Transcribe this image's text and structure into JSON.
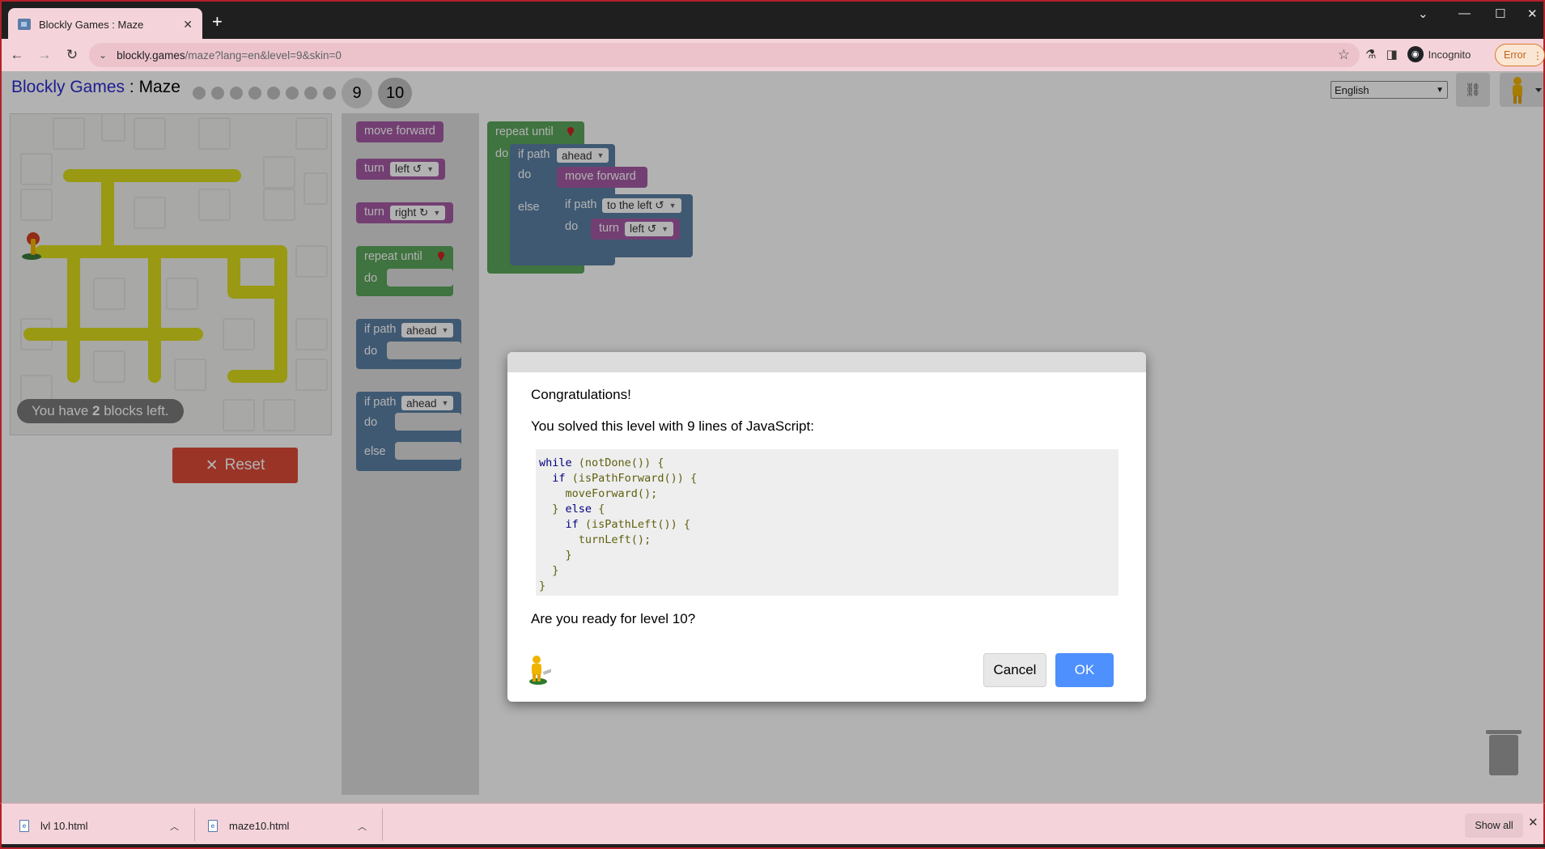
{
  "browser": {
    "tab_title": "Blockly Games : Maze",
    "tab_close": "✕",
    "new_tab": "+",
    "url_host": "blockly.games",
    "url_path": "/maze?lang=en&level=9&skin=0",
    "incognito_label": "Incognito",
    "error_label": "Error"
  },
  "page": {
    "title_link": "Blockly Games",
    "title_sep": " : ",
    "title_game": "Maze",
    "level_dots_count": 8,
    "level_current": "9",
    "level_next": "10",
    "language": "English",
    "blocks_left_prefix": "You have ",
    "blocks_left_count": "2",
    "blocks_left_suffix": " blocks left.",
    "reset_label": "Reset"
  },
  "toolbox": {
    "move_forward": "move forward",
    "turn": "turn",
    "left": "left ↺",
    "right": "right ↻",
    "repeat_until": "repeat until",
    "do": "do",
    "if_path": "if path",
    "ahead": "ahead",
    "else": "else"
  },
  "workspace": {
    "repeat_until": "repeat until",
    "do": "do",
    "if_path": "if path",
    "ahead": "ahead",
    "move_forward": "move forward",
    "else": "else",
    "to_the_left": "to the left ↺",
    "turn": "turn",
    "left": "left ↺"
  },
  "dialog": {
    "congrats": "Congratulations!",
    "solved": "You solved this level with 9 lines of JavaScript:",
    "code": [
      "while (notDone()) {",
      "  if (isPathForward()) {",
      "    moveForward();",
      "  } else {",
      "    if (isPathLeft()) {",
      "      turnLeft();",
      "    }",
      "  }",
      "}"
    ],
    "ready": "Are you ready for level 10?",
    "cancel": "Cancel",
    "ok": "OK"
  },
  "downloads": {
    "item1": "lvl 10.html",
    "item2": "maze10.html",
    "show_all": "Show all"
  },
  "colors": {
    "motion_block": "#a55ba5",
    "loop_block": "#5ba55b",
    "logic_block": "#5b80a5",
    "road": "#dcdc1c",
    "ok_button": "#4d90fe",
    "reset_button": "#dd4b39"
  }
}
